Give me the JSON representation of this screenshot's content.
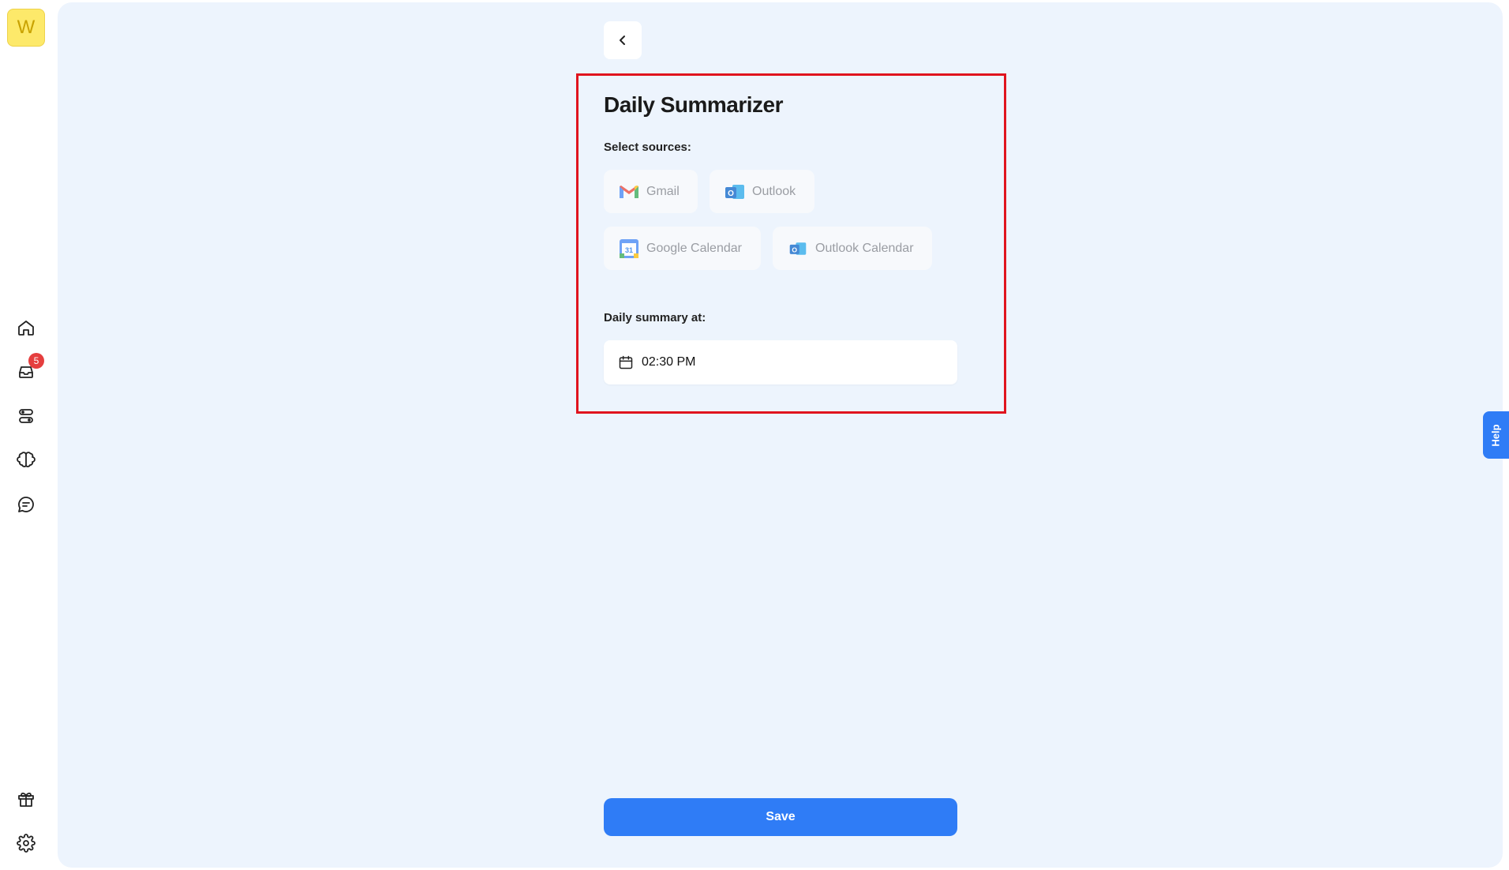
{
  "sidebar": {
    "logo_letter": "W",
    "inbox_badge": "5",
    "icons": [
      "home-icon",
      "inbox-icon",
      "apps-icon",
      "brain-icon",
      "chat-icon",
      "gift-icon",
      "gear-icon"
    ]
  },
  "page": {
    "title": "Daily Summarizer",
    "sources_label": "Select sources:",
    "sources": [
      {
        "label": "Gmail",
        "icon": "gmail-icon"
      },
      {
        "label": "Outlook",
        "icon": "outlook-icon"
      },
      {
        "label": "Google Calendar",
        "icon": "google-calendar-icon"
      },
      {
        "label": "Outlook Calendar",
        "icon": "outlook-calendar-icon"
      }
    ],
    "summary_label": "Daily summary at:",
    "summary_time": "02:30 PM",
    "save_label": "Save",
    "help_label": "Help"
  },
  "colors": {
    "accent": "#2f7cf6",
    "highlight_border": "#e0141e",
    "badge": "#e53e3e",
    "logo_bg": "#fde96a",
    "main_bg": "#edf4fd"
  }
}
